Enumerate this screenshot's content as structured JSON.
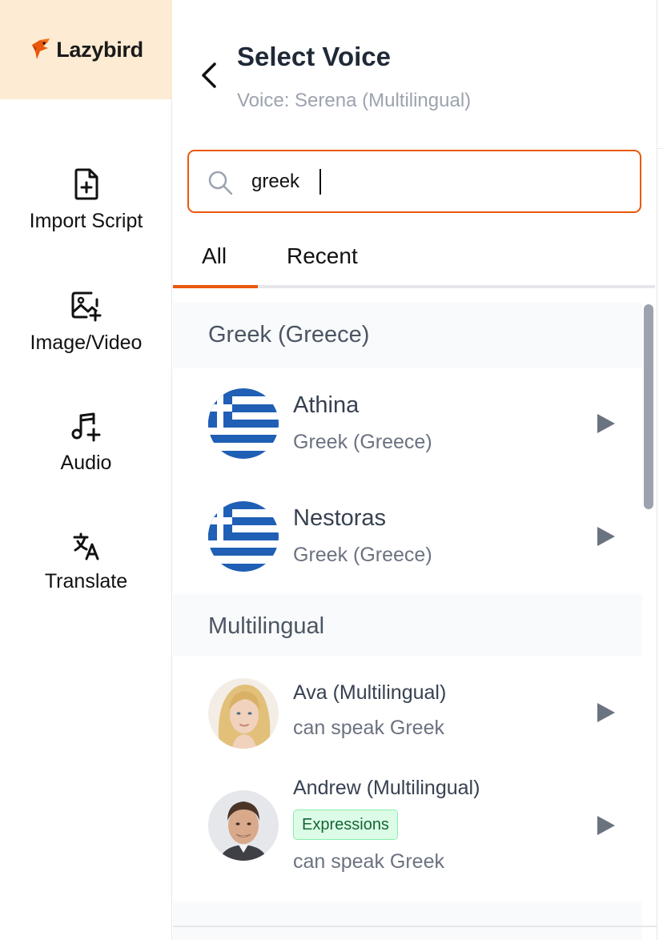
{
  "brand": {
    "name": "Lazybird",
    "accent": "#ea580c",
    "sidebar_top_bg": "#fdebd3"
  },
  "sidebar": {
    "items": [
      {
        "label": "Import Script",
        "icon": "file-plus-icon"
      },
      {
        "label": "Image/Video",
        "icon": "image-plus-icon"
      },
      {
        "label": "Audio",
        "icon": "music-plus-icon"
      },
      {
        "label": "Translate",
        "icon": "translate-icon"
      }
    ]
  },
  "header": {
    "title": "Select Voice",
    "subtitle": "Voice: Serena (Multilingual)"
  },
  "search": {
    "value": "greek",
    "icon": "search-icon"
  },
  "tabs": [
    {
      "label": "All",
      "active": true
    },
    {
      "label": "Recent",
      "active": false
    }
  ],
  "groups": [
    {
      "title": "Greek (Greece)",
      "voices": [
        {
          "name": "Athina",
          "language": "Greek (Greece)",
          "avatar": "greek-flag"
        },
        {
          "name": "Nestoras",
          "language": "Greek (Greece)",
          "avatar": "greek-flag"
        }
      ]
    },
    {
      "title": "Multilingual",
      "voices": [
        {
          "name": "Ava (Multilingual)",
          "note": "can speak Greek",
          "avatar": "female-photo"
        },
        {
          "name": "Andrew (Multilingual)",
          "badge": "Expressions",
          "note": "can speak Greek",
          "avatar": "male-photo"
        }
      ]
    }
  ]
}
